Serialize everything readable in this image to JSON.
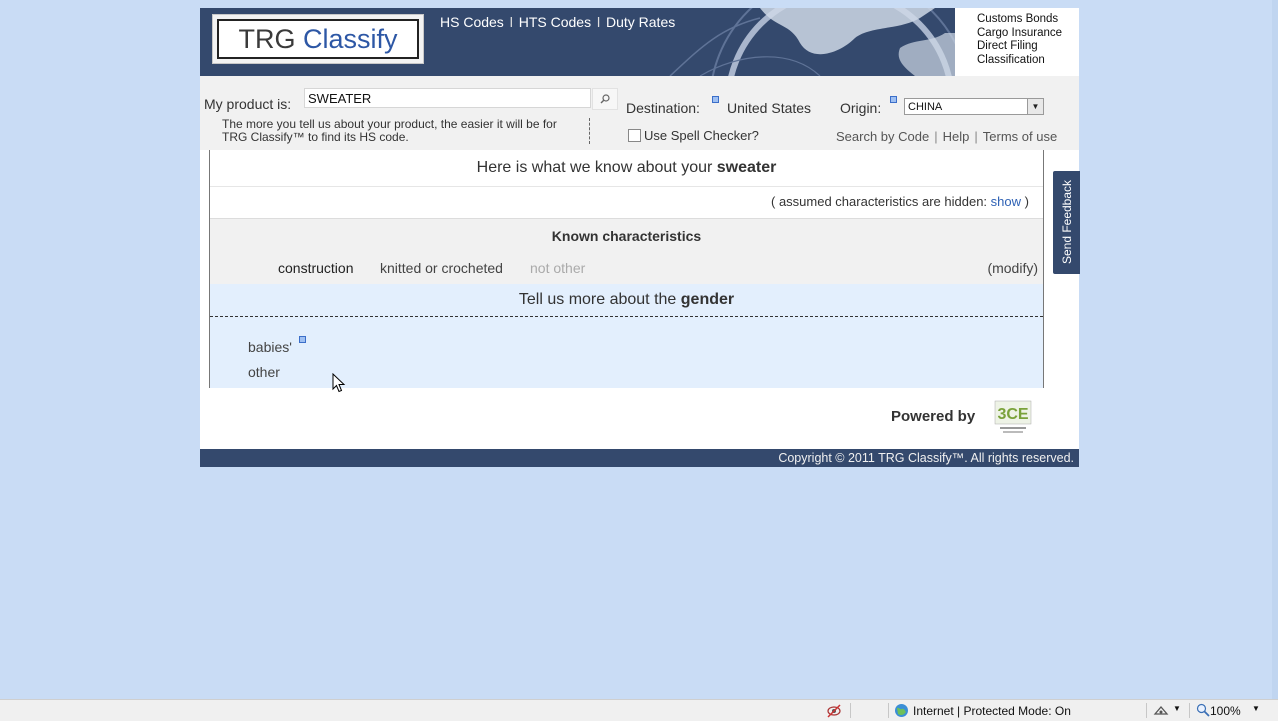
{
  "logo": {
    "part1": "TRG",
    "part2": "Classify"
  },
  "top_links": [
    "HS Codes",
    "HTS Codes",
    "Duty Rates"
  ],
  "top_links_separator": "l",
  "services": [
    "Customs Bonds",
    "Cargo Insurance",
    "Direct Filing",
    "Classification"
  ],
  "search": {
    "product_label": "My product is:",
    "product_value": "SWEATER",
    "destination_label": "Destination:",
    "destination_value": "United States",
    "origin_label": "Origin:",
    "origin_value": "CHINA",
    "hint": "The more you tell us about your product, the easier it will be for TRG Classify™ to find its HS code.",
    "spell_label": "Use Spell Checker?",
    "links": [
      "Search by Code",
      "Help",
      "Terms of use"
    ]
  },
  "panel": {
    "header_prefix": "Here is what we know about your",
    "header_product": "sweater",
    "assumed_prefix": "( assumed characteristics are hidden:",
    "assumed_link": "show",
    "assumed_suffix": ")",
    "known_title": "Known characteristics",
    "characteristic": {
      "name": "construction",
      "value": "knitted or crocheted",
      "other": "not other",
      "modify": "(modify)"
    },
    "gender_prefix": "Tell us more about the",
    "gender_attr": "gender",
    "options": [
      "babies'",
      "other"
    ]
  },
  "powered_by": "Powered by",
  "partner_logo": "3CE",
  "footer": "Copyright © 2011 TRG Classify™. All rights reserved.",
  "feedback": "Send Feedback",
  "statusbar": {
    "zone": "Internet | Protected Mode: On",
    "zoom": "100%"
  },
  "colors": {
    "banner": "#34496d",
    "page_bg": "#c9dcf5",
    "gender_bg": "#e3effd",
    "link": "#2f62b5"
  }
}
